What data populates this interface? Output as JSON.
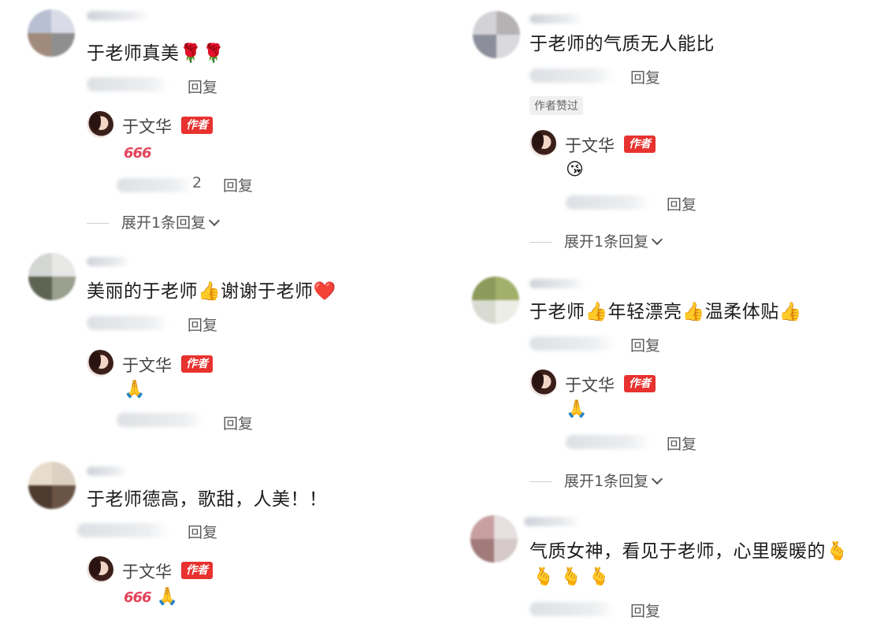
{
  "labels": {
    "reply": "回复",
    "author_badge": "作者",
    "liked_by_author": "作者赞过",
    "expand_replies": "展开1条回复"
  },
  "colors": {
    "author_badge_bg": "#e8322f",
    "accent_text": "#e3455b"
  },
  "left_column": [
    {
      "comment": "于老师真美🌹🌹",
      "reply": {
        "author": "于文华",
        "text": "666",
        "meta_suffix": "2",
        "emoji": ""
      },
      "expand": true
    },
    {
      "comment": "美丽的于老师👍谢谢于老师❤️",
      "reply": {
        "author": "于文华",
        "text": "",
        "meta_suffix": "",
        "emoji": "🙏"
      },
      "expand": false
    },
    {
      "comment": "于老师德高，歌甜，人美！！",
      "reply": {
        "author": "于文华",
        "text": "666",
        "meta_suffix": "",
        "emoji": "🙏"
      },
      "expand": false
    }
  ],
  "right_column": [
    {
      "comment": "于老师的气质无人能比",
      "liked": true,
      "reply": {
        "author": "于文华",
        "emoji": "😘"
      },
      "expand": true
    },
    {
      "comment": "于老师👍年轻漂亮👍温柔体贴👍",
      "liked": false,
      "reply": {
        "author": "于文华",
        "emoji": "🙏"
      },
      "expand": true
    },
    {
      "comment": "气质女神，看见于老师，心里暖暖的🫰",
      "comment_line2": "🫰 🫰 🫰",
      "liked": false
    }
  ]
}
